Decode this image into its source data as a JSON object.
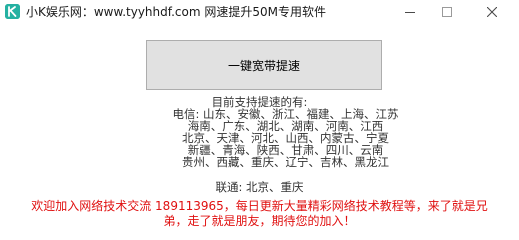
{
  "window": {
    "title": "小K娱乐网：www.tyyhhdf.com   网速提升50M专用软件",
    "icon": "k-logo-icon",
    "controls": [
      "minimize-icon",
      "maximize-icon",
      "close-icon"
    ]
  },
  "main": {
    "button_label": "一键宽带提速"
  },
  "support": {
    "heading": "目前支持提速的有:",
    "telecom_lines": [
      "电信: 山东、安徽、浙江、福建、上海、江苏",
      "海南、广东、湖北、湖南、河南、江西",
      "北京、天津、河北、山西、内蒙古、宁夏",
      "新疆、青海、陕西、甘肃、四川、云南",
      "贵州、西藏、重庆、辽宁、吉林、黑龙江"
    ],
    "unicom_line": "联通: 北京、重庆"
  },
  "footer": {
    "lines": [
      "欢迎加入网络技术交流 189113965，每日更新大量精彩网络技术教程等，来了就是兄",
      "弟，走了就是朋友，期待您的加入！"
    ],
    "color": "#e01010"
  }
}
